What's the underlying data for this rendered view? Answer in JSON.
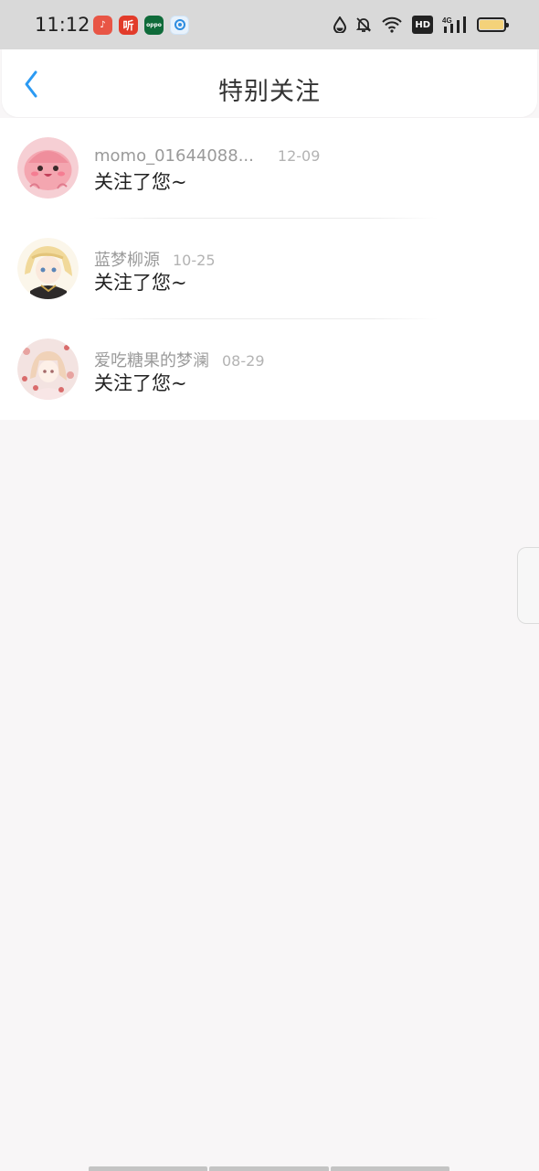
{
  "status_bar": {
    "time": "11:12",
    "app_icons": [
      {
        "name": "music-app-icon",
        "color": "#e85545",
        "glyph": "♪"
      },
      {
        "name": "listen-app-icon",
        "color": "#e23b2a",
        "glyph": "听"
      },
      {
        "name": "oppo-app-icon",
        "color": "#0f6b3a",
        "glyph": "oppo"
      },
      {
        "name": "browser-app-icon",
        "color": "#2e8de0",
        "glyph": "●"
      }
    ],
    "network": "4G",
    "hd_label": "HD",
    "battery_color": "#f4d27a"
  },
  "header": {
    "title": "特别关注",
    "back_icon": "chevron-left-icon",
    "accent_color": "#2b9af3"
  },
  "follows": [
    {
      "name": "momo_01644088...",
      "date": "12-09",
      "message": "关注了您~",
      "avatar": "pink-blob-avatar"
    },
    {
      "name": "蓝梦柳源",
      "date": "10-25",
      "message": "关注了您~",
      "avatar": "blonde-anime-avatar"
    },
    {
      "name": "爱吃糖果的梦澜",
      "date": "08-29",
      "message": "关注了您~",
      "avatar": "floral-anime-avatar"
    }
  ]
}
